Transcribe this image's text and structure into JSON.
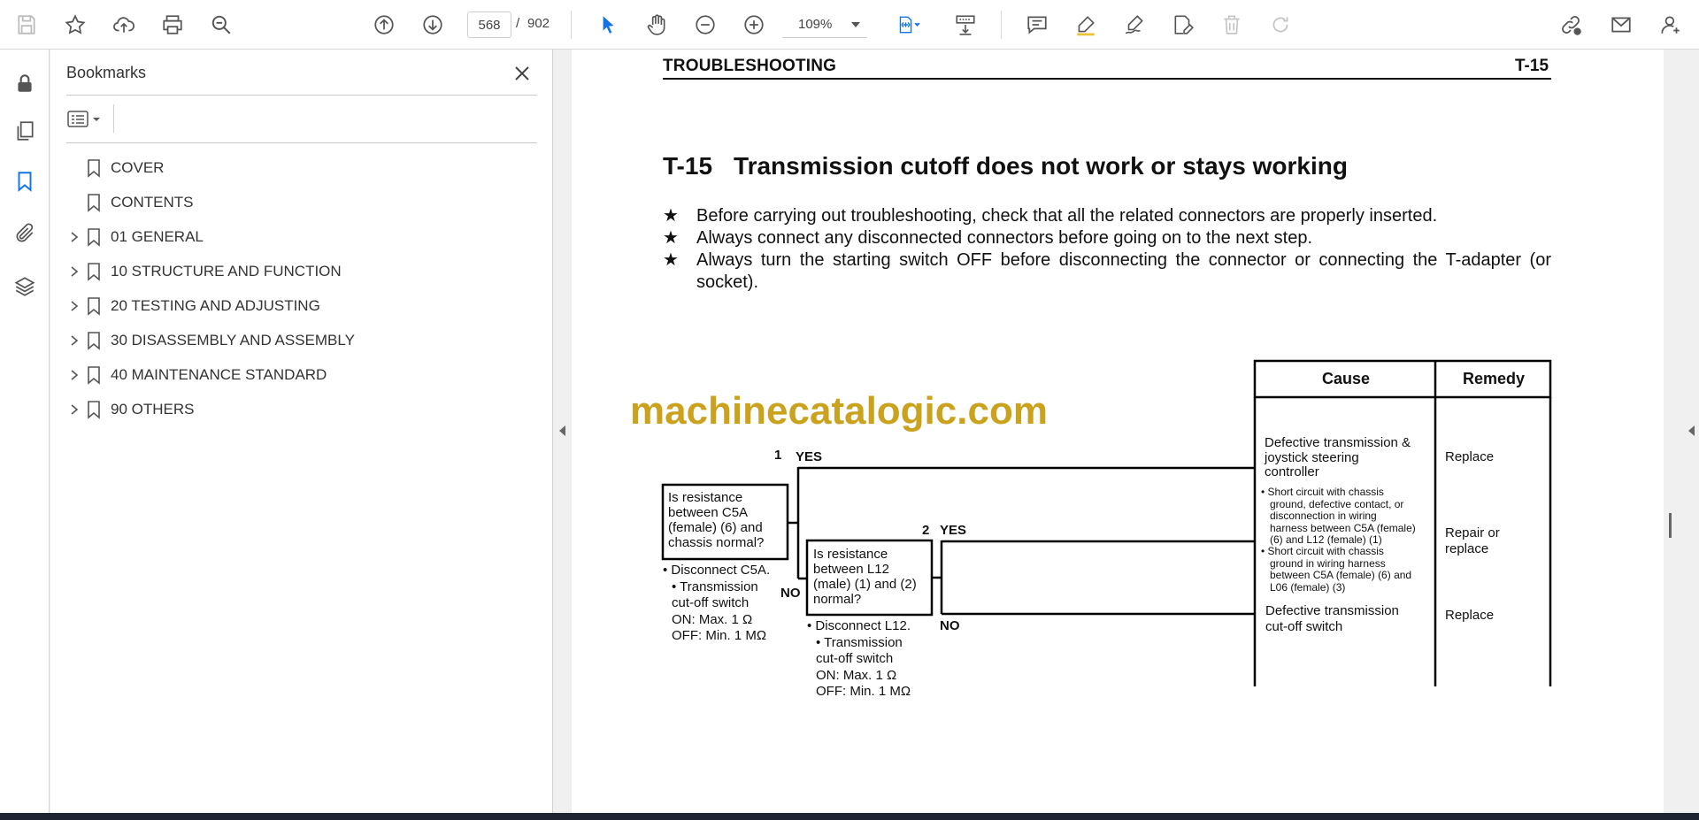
{
  "toolbar": {
    "page_current": "568",
    "page_total": "902",
    "zoom": "109%",
    "icons": [
      "save-icon",
      "star-icon",
      "upload-icon",
      "print-icon",
      "find-icon",
      "page-up-icon",
      "page-down-icon",
      "select-arrow-icon",
      "hand-icon",
      "zoom-out-icon",
      "zoom-in-icon",
      "fit-page-icon",
      "scroll-mode-icon",
      "comment-icon",
      "highlight-icon",
      "sign-icon",
      "edit-pdf-icon",
      "delete-icon",
      "redo-icon",
      "share-link-icon",
      "email-icon",
      "account-icon"
    ]
  },
  "leftrail": {
    "icons": [
      "lock-icon",
      "pages-icon",
      "bookmark-icon",
      "attachment-icon",
      "layers-icon"
    ]
  },
  "panel": {
    "title": "Bookmarks",
    "bookmarks": [
      {
        "label": "COVER",
        "expandable": false
      },
      {
        "label": "CONTENTS",
        "expandable": false
      },
      {
        "label": "01 GENERAL",
        "expandable": true
      },
      {
        "label": "10 STRUCTURE AND FUNCTION",
        "expandable": true
      },
      {
        "label": "20 TESTING AND ADJUSTING",
        "expandable": true
      },
      {
        "label": "30 DISASSEMBLY AND ASSEMBLY",
        "expandable": true
      },
      {
        "label": "40 MAINTENANCE STANDARD",
        "expandable": true
      },
      {
        "label": "90 OTHERS",
        "expandable": true
      }
    ]
  },
  "document": {
    "header_left": "TROUBLESHOOTING",
    "header_right": "T-15",
    "title_num": "T-15",
    "title_text": "Transmission cutoff does not work or stays working",
    "notes": [
      "Before carrying out troubleshooting, check that all the related connectors are properly inserted.",
      "Always connect any disconnected connectors before going on to the next step.",
      "Always turn the starting switch OFF before disconnecting the connector or connecting the T-adapter (or socket)."
    ],
    "star": "★",
    "watermark": "machinecatalogic.com",
    "flowchart": {
      "col_cause": "Cause",
      "col_remedy": "Remedy",
      "step1_num": "1",
      "step1_q": [
        "Is resistance",
        "between C5A",
        "(female) (6) and",
        "chassis normal?"
      ],
      "step1_notes": [
        "• Disconnect C5A.",
        "• Transmission",
        "cut-off switch",
        "ON: Max. 1 Ω",
        "OFF: Min. 1 MΩ"
      ],
      "step2_num": "2",
      "step2_q": [
        "Is resistance",
        "between L12",
        "(male) (1) and (2)",
        "normal?"
      ],
      "step2_notes": [
        "• Disconnect L12.",
        "• Transmission",
        "cut-off switch",
        "ON: Max. 1 Ω",
        "OFF: Min. 1 MΩ"
      ],
      "yes": "YES",
      "no": "NO",
      "cause1": [
        "Defective transmission &",
        "joystick steering",
        "controller"
      ],
      "remedy1": "Replace",
      "cause2a": [
        "• Short circuit with chassis",
        "ground, defective contact, or",
        "disconnection in wiring",
        "harness between C5A (female)",
        "(6) and L12 (female) (1)"
      ],
      "cause2b": [
        "• Short circuit with chassis",
        "ground in wiring harness",
        "between C5A (female) (6) and",
        "L06 (female) (3)"
      ],
      "remedy2": [
        "Repair or",
        "replace"
      ],
      "cause3": [
        "Defective transmission",
        "cut-off switch"
      ],
      "remedy3": "Replace"
    }
  }
}
